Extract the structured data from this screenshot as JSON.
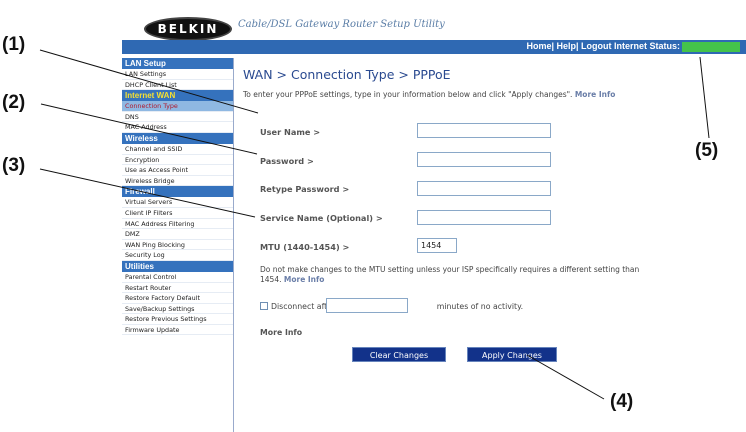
{
  "callouts": {
    "c1": "(1)",
    "c2": "(2)",
    "c3": "(3)",
    "c4": "(4)",
    "c5": "(5)"
  },
  "header": {
    "logo": "BELKIN",
    "title": "Cable/DSL Gateway Router Setup Utility",
    "links": "Home| Help| Logout   Internet Status:",
    "status_color": "#44c34a"
  },
  "sidebar": {
    "sections": [
      {
        "title": "LAN Setup",
        "items": [
          "LAN Settings",
          "DHCP Client List"
        ]
      },
      {
        "title": "Internet WAN",
        "items": [
          "Connection Type",
          "DNS",
          "MAC Address"
        ]
      },
      {
        "title": "Wireless",
        "items": [
          "Channel and SSID",
          "Encryption",
          "Use as Access Point",
          "Wireless Bridge"
        ]
      },
      {
        "title": "Firewall",
        "items": [
          "Virtual Servers",
          "Client IP Filters",
          "MAC Address Filtering",
          "DMZ",
          "WAN Ping Blocking",
          "Security Log"
        ]
      },
      {
        "title": "Utilities",
        "items": [
          "Parental Control",
          "Restart Router",
          "Restore Factory Default",
          "Save/Backup Settings",
          "Restore Previous Settings",
          "Firmware Update"
        ]
      }
    ]
  },
  "main": {
    "page_title": "WAN > Connection Type > PPPoE",
    "intro": "To enter your PPPoE settings, type in your information below and click \"Apply changes\".",
    "intro_more": "More Info",
    "fields": {
      "user_name": "User Name >",
      "password": "Password >",
      "retype_password": "Retype Password >",
      "service_name": "Service Name (Optional) >",
      "mtu": "MTU (1440-1454) >"
    },
    "mtu_value": "1454",
    "mtu_note": "Do not make changes to the MTU setting unless your ISP specifically requires a different setting than 1454.",
    "mtu_note_more": "More Info",
    "disconnect_before": "Disconnect after",
    "disconnect_after": "minutes of no activity.",
    "more_info": "More Info",
    "clear_button": "Clear Changes",
    "apply_button": "Apply Changes"
  }
}
